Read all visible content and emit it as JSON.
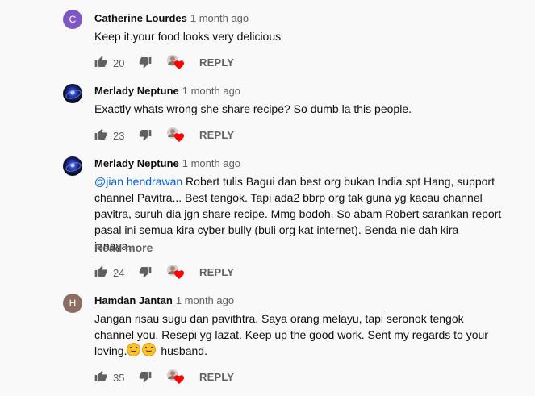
{
  "comments": [
    {
      "avatar_letter": "C",
      "author": "Catherine Lourdes",
      "time": "1 month ago",
      "text": "Keep it.your food looks very delicious",
      "likes": "20",
      "reply_label": "REPLY"
    },
    {
      "author": "Merlady Neptune",
      "time": "1 month ago",
      "text": "Exactly whats wrong she share recipe? So dumb la this people.",
      "likes": "23",
      "reply_label": "REPLY"
    },
    {
      "author": "Merlady Neptune",
      "time": "1 month ago",
      "mention": "@jian hendrawan",
      "text": " Robert tulis Bagui dan best org bukan India spt Hang, support channel Pavitra... Best tengok. Tapi ada2 bbrp org tak guna yg kacau channel pavitra, suruh dia jgn share recipe. Mmg bodoh. So abam Robert sarankan report pasal ini semua kira cyber bully (buli org kat internet). Benda nie dah kira jenaya…",
      "read_more": "Read more",
      "likes": "24",
      "reply_label": "REPLY"
    },
    {
      "avatar_letter": "H",
      "author": "Hamdan Jantan",
      "time": "1 month ago",
      "text_before_emoji": "Jangan risau sugu dan pavithtra. Saya orang melayu, tapi seronok tengok channel you. Resepi yg lazat. Keep up the good work. Sent my regards to your loving.",
      "text_after_emoji": " husband.",
      "likes": "35",
      "reply_label": "REPLY"
    }
  ],
  "colors": {
    "background": "#f9f9f9",
    "author": "#0f0f0f",
    "meta": "#606060",
    "mention": "#065fd4",
    "heart": "#ff0000"
  },
  "icons": [
    "thumb-up-icon",
    "thumb-down-icon",
    "creator-heart-icon",
    "avatar"
  ]
}
